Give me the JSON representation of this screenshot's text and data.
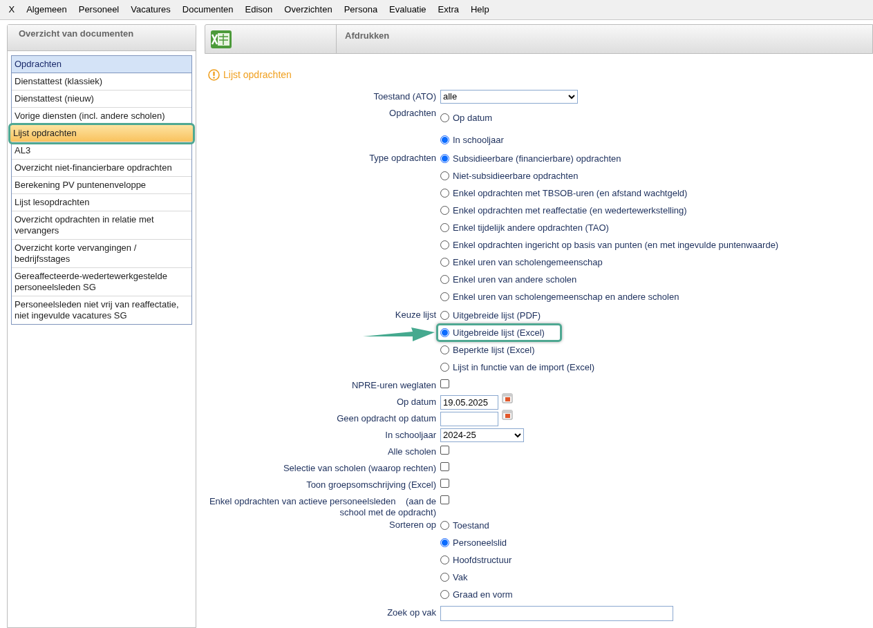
{
  "menu": [
    "X",
    "Algemeen",
    "Personeel",
    "Vacatures",
    "Documenten",
    "Edison",
    "Overzichten",
    "Persona",
    "Evaluatie",
    "Extra",
    "Help"
  ],
  "sidebar": {
    "title": "Overzicht van documenten",
    "items": [
      {
        "label": "Opdrachten",
        "kind": "header",
        "selected": false,
        "highlighted": false
      },
      {
        "label": "Dienstattest (klassiek)",
        "kind": "item",
        "selected": false,
        "highlighted": false
      },
      {
        "label": "Dienstattest (nieuw)",
        "kind": "item",
        "selected": false,
        "highlighted": false
      },
      {
        "label": "Vorige diensten (incl. andere scholen)",
        "kind": "item",
        "selected": false,
        "highlighted": false
      },
      {
        "label": "Lijst opdrachten",
        "kind": "item",
        "selected": true,
        "highlighted": true
      },
      {
        "label": "AL3",
        "kind": "item",
        "selected": false,
        "highlighted": false
      },
      {
        "label": "Overzicht niet-financierbare opdrachten",
        "kind": "item",
        "selected": false,
        "highlighted": false
      },
      {
        "label": "Berekening PV puntenenveloppe",
        "kind": "item",
        "selected": false,
        "highlighted": false
      },
      {
        "label": "Lijst lesopdrachten",
        "kind": "item",
        "selected": false,
        "highlighted": false
      },
      {
        "label": "Overzicht opdrachten in relatie met vervangers",
        "kind": "item",
        "selected": false,
        "highlighted": false
      },
      {
        "label": "Overzicht korte vervangingen / bedrijfsstages",
        "kind": "item",
        "selected": false,
        "highlighted": false
      },
      {
        "label": "Gereaffecteerde-wedertewerkgestelde personeelsleden SG",
        "kind": "item",
        "selected": false,
        "highlighted": false
      },
      {
        "label": "Personeelsleden niet vrij van reaffectatie, niet ingevulde vacatures SG",
        "kind": "item",
        "selected": false,
        "highlighted": false
      }
    ]
  },
  "toolbar": {
    "title": "Afdrukken"
  },
  "form": {
    "title": "Lijst opdrachten",
    "rows": [
      {
        "kind": "select",
        "label": "Toestand (ATO)",
        "value": "alle"
      },
      {
        "kind": "radio",
        "label": "Opdrachten",
        "options": [
          {
            "label": "Op datum",
            "selected": false,
            "highlighted": false
          },
          {
            "label": "In schooljaar",
            "selected": true,
            "highlighted": false
          }
        ]
      },
      {
        "kind": "radio",
        "label": "Type opdrachten",
        "options": [
          {
            "label": "Subsidieerbare (financierbare) opdrachten",
            "selected": true,
            "highlighted": false
          },
          {
            "label": "Niet-subsidieerbare opdrachten",
            "selected": false,
            "highlighted": false
          },
          {
            "label": "Enkel opdrachten met TBSOB-uren (en afstand wachtgeld)",
            "selected": false,
            "highlighted": false
          },
          {
            "label": "Enkel opdrachten met reaffectatie (en wedertewerkstelling)",
            "selected": false,
            "highlighted": false
          },
          {
            "label": "Enkel tijdelijk andere opdrachten (TAO)",
            "selected": false,
            "highlighted": false
          },
          {
            "label": "Enkel opdrachten ingericht op basis van punten (en met ingevulde puntenwaarde)",
            "selected": false,
            "highlighted": false
          },
          {
            "label": "Enkel uren van scholengemeenschap",
            "selected": false,
            "highlighted": false
          },
          {
            "label": "Enkel uren van andere scholen",
            "selected": false,
            "highlighted": false
          },
          {
            "label": "Enkel uren van scholengemeenschap en andere scholen",
            "selected": false,
            "highlighted": false
          }
        ]
      },
      {
        "kind": "radio",
        "label": "Keuze lijst",
        "options": [
          {
            "label": "Uitgebreide lijst (PDF)",
            "selected": false,
            "highlighted": false
          },
          {
            "label": "Uitgebreide lijst (Excel)",
            "selected": true,
            "highlighted": true
          },
          {
            "label": "Beperkte lijst (Excel)",
            "selected": false,
            "highlighted": false
          },
          {
            "label": "Lijst in functie van de import (Excel)",
            "selected": false,
            "highlighted": false
          }
        ]
      },
      {
        "kind": "checkbox",
        "label": "NPRE-uren weglaten",
        "checked": false
      },
      {
        "kind": "date",
        "label": "Op datum",
        "value": "19.05.2025"
      },
      {
        "kind": "date",
        "label": "Geen opdracht op datum"
      },
      {
        "kind": "select",
        "label": "In schooljaar",
        "value": "2024-25"
      },
      {
        "kind": "checkbox",
        "label": "Alle scholen",
        "checked": false
      },
      {
        "kind": "checkbox",
        "label": "Selectie van scholen (waarop rechten)",
        "checked": false
      },
      {
        "kind": "checkbox",
        "label": "Toon groepsomschrijving (Excel)",
        "checked": false
      },
      {
        "kind": "checkbox",
        "label": "Enkel opdrachten van actieve personeelsleden    (aan de school met de opdracht)",
        "checked": false
      },
      {
        "kind": "radio",
        "label": "Sorteren op",
        "options": [
          {
            "label": "Toestand",
            "selected": false,
            "highlighted": false
          },
          {
            "label": "Personeelslid",
            "selected": true,
            "highlighted": false
          },
          {
            "label": "Hoofdstructuur",
            "selected": false,
            "highlighted": false
          },
          {
            "label": "Vak",
            "selected": false,
            "highlighted": false
          },
          {
            "label": "Graad en vorm",
            "selected": false,
            "highlighted": false
          }
        ]
      },
      {
        "kind": "text",
        "label": "Zoek op vak"
      }
    ]
  }
}
